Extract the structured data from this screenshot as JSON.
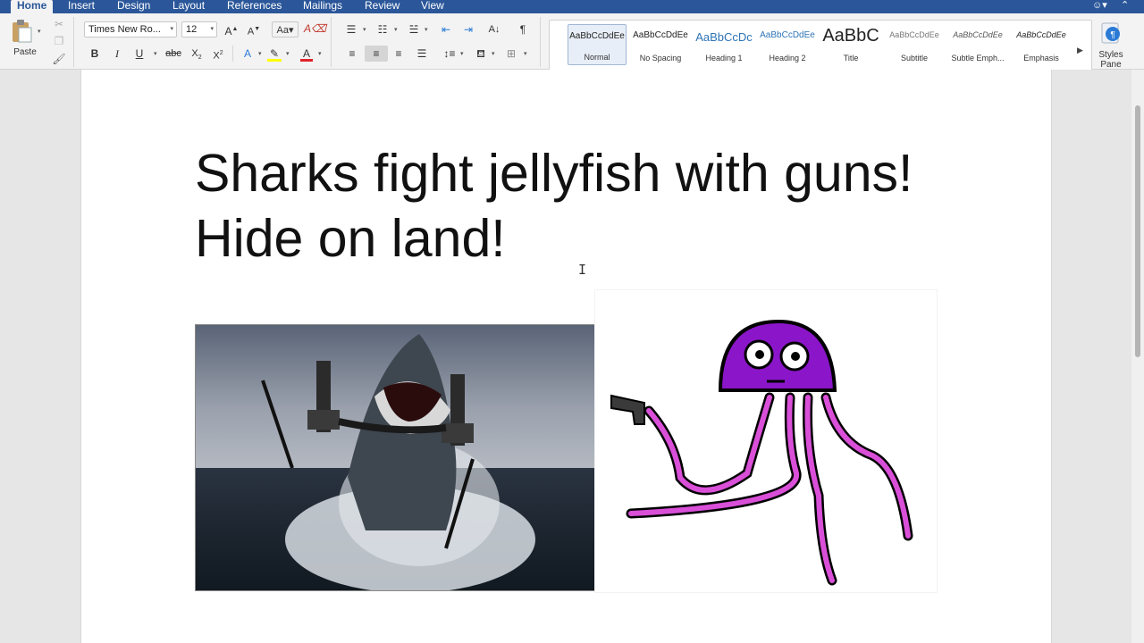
{
  "ribbon_tabs": [
    "Home",
    "Insert",
    "Design",
    "Layout",
    "References",
    "Mailings",
    "Review",
    "View"
  ],
  "active_tab": "Home",
  "clipboard": {
    "paste_label": "Paste"
  },
  "font": {
    "family_value": "Times New Ro...",
    "size_value": "12"
  },
  "styles_gallery": [
    {
      "sample": "AaBbCcDdEe",
      "name": "Normal"
    },
    {
      "sample": "AaBbCcDdEe",
      "name": "No Spacing"
    },
    {
      "sample": "AaBbCcDc",
      "name": "Heading 1"
    },
    {
      "sample": "AaBbCcDdEe",
      "name": "Heading 2"
    },
    {
      "sample": "AaBbC",
      "name": "Title"
    },
    {
      "sample": "AaBbCcDdEe",
      "name": "Subtitle"
    },
    {
      "sample": "AaBbCcDdEe",
      "name": "Subtle Emph..."
    },
    {
      "sample": "AaBbCcDdEe",
      "name": "Emphasis"
    }
  ],
  "styles_pane": {
    "label_line1": "Styles",
    "label_line2": "Pane"
  },
  "document": {
    "headline_line1": "Sharks fight jellyfish with guns!",
    "headline_line2": "Hide on land!"
  },
  "colors": {
    "tab_bar": "#2b579a",
    "ribbon": "#f3f3f3",
    "highlight_yellow": "#ffff00",
    "font_color_red": "#e0242a",
    "jellyfish_purple": "#8b16c9",
    "tentacle_pink": "#d94fd8"
  },
  "icons": [
    "paste-icon",
    "cut-icon",
    "copy-icon",
    "format-painter-icon",
    "clear-formatting-icon",
    "pilcrow-icon",
    "smiley-icon",
    "collapse-ribbon-icon",
    "styles-pane-icon"
  ]
}
